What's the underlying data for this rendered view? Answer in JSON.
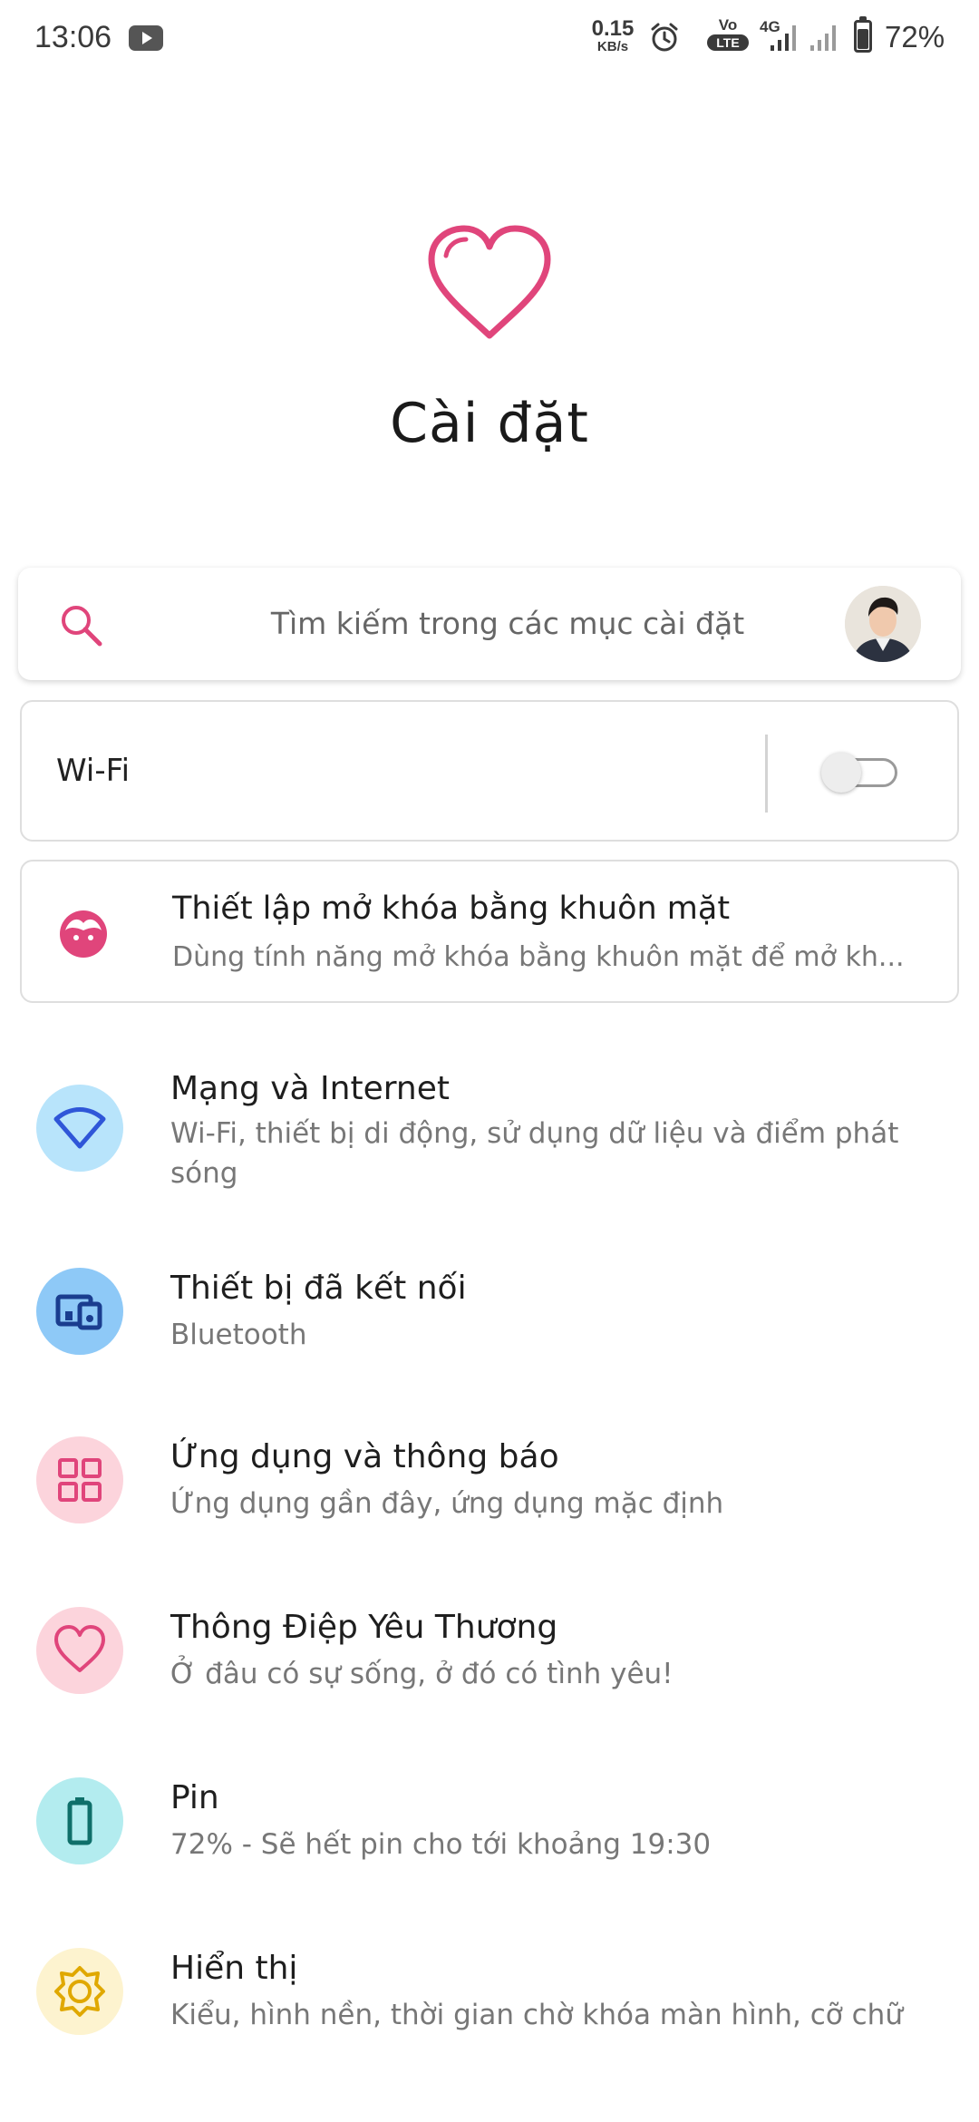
{
  "status_bar": {
    "time": "13:06",
    "net_speed_value": "0.15",
    "net_speed_unit": "KB/s",
    "volte_top": "Vo",
    "volte_bottom": "LTE",
    "network_type": "4G",
    "battery_percent": "72%",
    "battery_level": 0.72,
    "icons": [
      "youtube-icon",
      "alarm-icon",
      "volte-icon",
      "signal-icon",
      "signal-icon",
      "battery-icon"
    ]
  },
  "header": {
    "title": "Cài đặt",
    "logo_icon": "heart-icon",
    "accent_color": "#e0457b"
  },
  "search": {
    "placeholder": "Tìm kiếm trong các mục cài đặt",
    "icon": "search-icon"
  },
  "wifi": {
    "label": "Wi-Fi",
    "enabled": false
  },
  "face_unlock": {
    "title": "Thiết lập mở khóa bằng khuôn mặt",
    "subtitle": "Dùng tính năng mở khóa bằng khuôn mặt để mở kh..."
  },
  "settings": [
    {
      "title": "Mạng và Internet",
      "subtitle": "Wi-Fi, thiết bị di động, sử dụng dữ liệu và điểm phát sóng",
      "icon": "wifi-icon",
      "bg": "#b8e4fb",
      "fg": "#2f56d8"
    },
    {
      "title": "Thiết bị đã kết nối",
      "subtitle": "Bluetooth",
      "icon": "devices-icon",
      "bg": "#8ec9f7",
      "fg": "#1a3d8f"
    },
    {
      "title": "Ứng dụng và thông báo",
      "subtitle": "Ứng dụng gần đây, ứng dụng mặc định",
      "icon": "apps-grid-icon",
      "bg": "#fcd4dc",
      "fg": "#e0457b"
    },
    {
      "title": "Thông Điệp Yêu Thương",
      "subtitle": "Ở đâu có sự sống, ở đó có tình yêu!",
      "icon": "heart-icon",
      "bg": "#fcd4dc",
      "fg": "#e0457b"
    },
    {
      "title": "Pin",
      "subtitle": "72% - Sẽ hết pin cho tới khoảng 19:30",
      "icon": "battery-icon",
      "bg": "#b3ecef",
      "fg": "#0f6f6a"
    },
    {
      "title": "Hiển thị",
      "subtitle": "Kiểu, hình nền, thời gian chờ khóa màn hình, cỡ chữ",
      "icon": "brightness-icon",
      "bg": "#fdf3cf",
      "fg": "#e0a800"
    }
  ]
}
